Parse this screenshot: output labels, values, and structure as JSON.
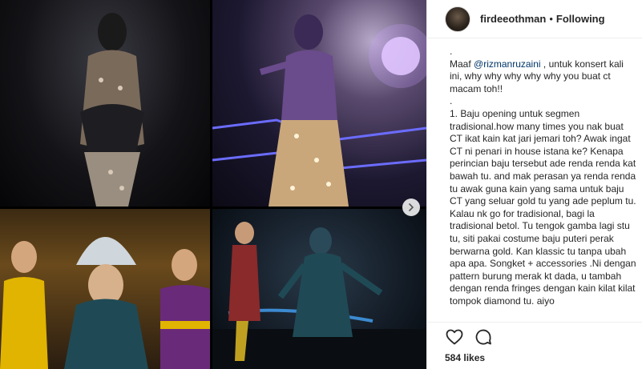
{
  "post": {
    "username": "firdeeothman",
    "separator": "•",
    "follow_status": "Following",
    "caption": {
      "line0": ".",
      "intro_prefix": "Maaf ",
      "mention": "@rizmanruzaini",
      "intro_suffix": " , untuk konsert kali ini, why why why why why you buat ct macam toh!!",
      "line2": ".",
      "body": "1. Baju opening untuk segmen tradisional.how many times you nak buat CT ikat kain kat jari jemari toh? Awak ingat CT ni penari in house istana ke? Kenapa perincian baju tersebut ade renda renda kat bawah tu. and mak perasan ya renda renda tu awak guna kain yang sama untuk baju CT yang seluar gold tu yang ade peplum tu. Kalau nk go for tradisional, bagi la tradisional betol. Tu tengok gamba lagi stu tu, siti pakai costume baju puteri perak berwarna gold. Kan klassic tu tanpa ubah apa apa. Songket + accessories .Ni dengan pattern burung merak kt dada, u tambah dengan renda fringes dengan kain kilat kilat tompok diamond tu. aiyo"
    },
    "likes": "584 likes"
  },
  "icons": {
    "avatar": "profile-avatar",
    "next": "chevron-right-icon",
    "like": "heart-icon",
    "comment": "comment-icon"
  },
  "colors": {
    "text": "#262626",
    "mention": "#003569",
    "border": "#efefef"
  }
}
